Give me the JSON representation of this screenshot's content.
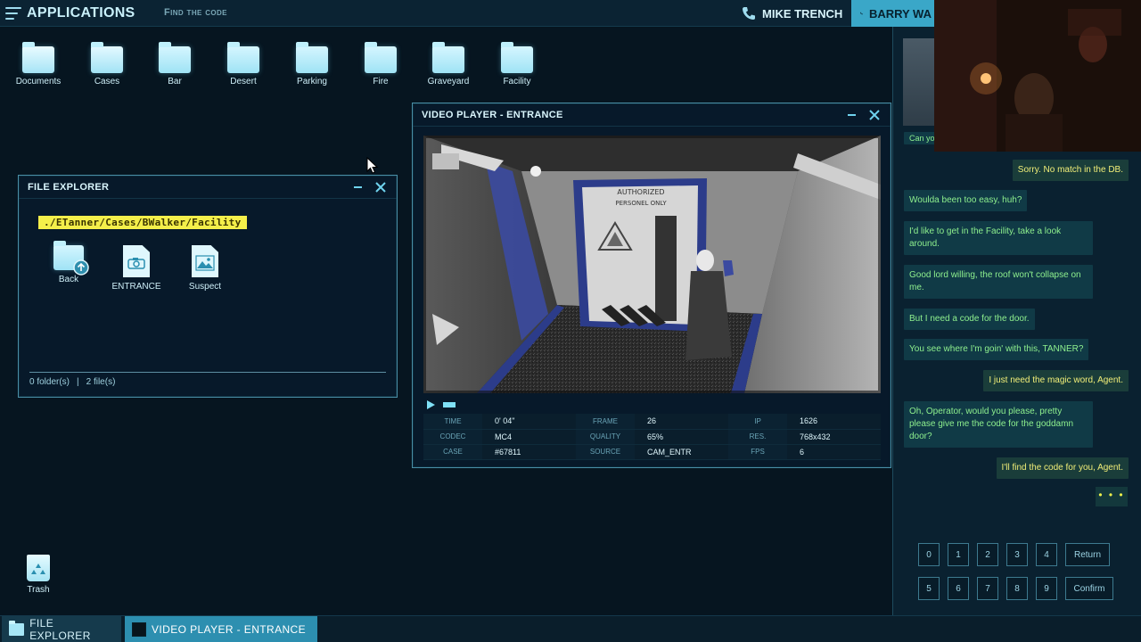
{
  "topbar": {
    "title": "Applications",
    "objective": "Find the code",
    "contacts": [
      {
        "name": "MIKE TRENCH"
      },
      {
        "name": "BARRY WA"
      }
    ]
  },
  "desktop": {
    "icons": [
      {
        "label": "Documents"
      },
      {
        "label": "Cases"
      },
      {
        "label": "Bar"
      },
      {
        "label": "Desert"
      },
      {
        "label": "Parking"
      },
      {
        "label": "Fire"
      },
      {
        "label": "Graveyard"
      },
      {
        "label": "Facility"
      }
    ],
    "trash_label": "Trash"
  },
  "file_explorer": {
    "title": "FILE EXPLORER",
    "path": "./ETanner/Cases/BWalker/Facility",
    "items": [
      {
        "label": "Back",
        "icon": "folder-back-icon"
      },
      {
        "label": "ENTRANCE",
        "icon": "video-file-icon"
      },
      {
        "label": "Suspect",
        "icon": "image-file-icon"
      }
    ],
    "status_folders": "0 folder(s)",
    "status_sep": "|",
    "status_files": "2 file(s)"
  },
  "video_player": {
    "title": "VIDEO PLAYER - ENTRANCE",
    "door_sign_line1": "AUTHORIZED",
    "door_sign_line2": "PERSONEL ONLY",
    "progress": 0.03,
    "meta": [
      [
        {
          "k": "TIME",
          "v": "0' 04\""
        },
        {
          "k": "FRAME",
          "v": "26"
        },
        {
          "k": "IP",
          "v": "1626"
        }
      ],
      [
        {
          "k": "CODEC",
          "v": "MC4"
        },
        {
          "k": "QUALITY",
          "v": "65%"
        },
        {
          "k": "RES.",
          "v": "768x432"
        }
      ],
      [
        {
          "k": "CASE",
          "v": "#67811"
        },
        {
          "k": "SOURCE",
          "v": "CAM_ENTR"
        },
        {
          "k": "FPS",
          "v": "6"
        }
      ]
    ]
  },
  "chat": {
    "partial_top": "Can yo",
    "messages": [
      {
        "dir": "out",
        "text": "Sorry. No match in the DB."
      },
      {
        "dir": "in",
        "text": "Woulda been too easy, huh?"
      },
      {
        "dir": "in",
        "text": "I'd like to get in the Facility, take a look around."
      },
      {
        "dir": "in",
        "text": "Good lord willing, the roof won't collapse on me."
      },
      {
        "dir": "in",
        "text": "But I need a code for the door."
      },
      {
        "dir": "in",
        "text": "You see where I'm goin' with this, TANNER?"
      },
      {
        "dir": "out",
        "text": "I just need the magic word, Agent."
      },
      {
        "dir": "in",
        "text": "Oh, Operator, would you please, pretty please give me the code for the goddamn door?"
      },
      {
        "dir": "out",
        "text": "I'll find the code for you, Agent."
      }
    ],
    "typing": "• • •",
    "keypad": {
      "row1": [
        "0",
        "1",
        "2",
        "3",
        "4"
      ],
      "row2": [
        "5",
        "6",
        "7",
        "8",
        "9"
      ],
      "return_label": "Return",
      "confirm_label": "Confirm"
    }
  },
  "taskbar": {
    "tasks": [
      {
        "label": "FILE EXPLORER"
      },
      {
        "label": "VIDEO PLAYER - ENTRANCE"
      }
    ]
  },
  "colors": {
    "background": "#061520",
    "accent": "#3aa7c8",
    "chat_in": "#8ef08e",
    "chat_out": "#f1ee78",
    "path_chip": "#f4ef4a"
  }
}
